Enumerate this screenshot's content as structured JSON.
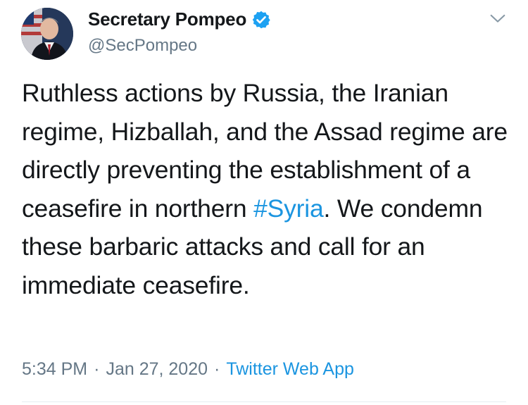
{
  "author": {
    "display_name": "Secretary Pompeo",
    "handle": "@SecPompeo",
    "verified": true
  },
  "tweet": {
    "text_before": "Ruthless actions by Russia, the Iranian regime, Hizballah, and the Assad regime are directly preventing the establishment of a ceasefire in northern ",
    "hashtag": "#Syria",
    "text_after": ". We condemn these barbaric attacks and call for an immediate ceasefire."
  },
  "meta": {
    "time": "5:34 PM",
    "separator": "·",
    "date": "Jan 27, 2020",
    "source": "Twitter Web App"
  },
  "colors": {
    "link": "#1b95e0",
    "secondary_text": "#657786",
    "verified_badge": "#1da1f2"
  },
  "icons": {
    "verified": "verified-badge-icon",
    "menu": "chevron-down-icon"
  }
}
